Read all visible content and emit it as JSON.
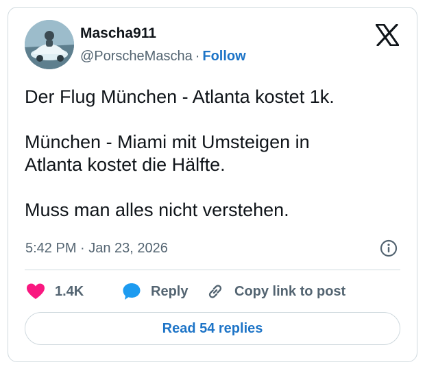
{
  "author": {
    "name": "Mascha911",
    "handle": "@PorscheMascha",
    "separator": "·",
    "follow_label": "Follow"
  },
  "tweet": {
    "paragraphs": [
      [
        "Der Flug München - Atlanta kostet 1k."
      ],
      [
        "München - Miami mit Umsteigen in",
        "Atlanta kostet die Hälfte."
      ],
      [
        "Muss man alles nicht verstehen."
      ]
    ],
    "timestamp": "5:42 PM · Jan 23, 2026"
  },
  "actions": {
    "like_count": "1.4K",
    "reply_label": "Reply",
    "copy_label": "Copy link to post"
  },
  "read_replies_label": "Read 54 replies",
  "icons": {
    "brand": "x-logo-icon",
    "info": "info-icon",
    "like": "heart-icon",
    "reply": "speech-bubble-icon",
    "copy": "link-icon"
  },
  "colors": {
    "like": "#f91880",
    "reply": "#1d9bf0",
    "link": "#1d74c7",
    "secondary_text": "#536471",
    "border": "#cfd9de"
  }
}
